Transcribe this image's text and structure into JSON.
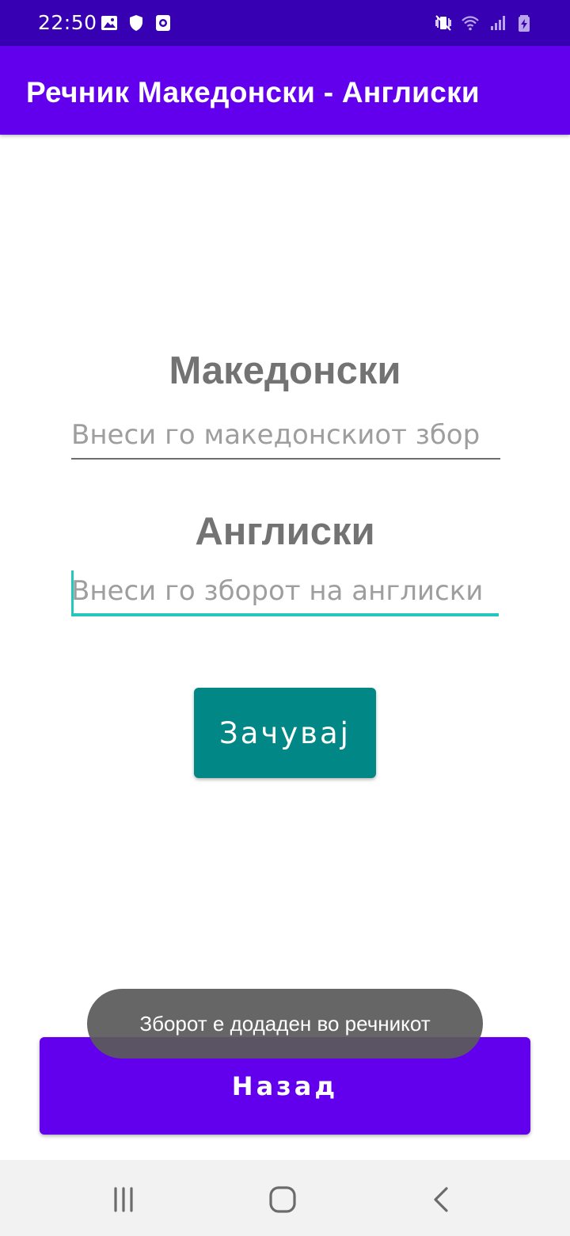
{
  "status_bar": {
    "time": "22:50",
    "left_icons": [
      "image-icon",
      "shield-icon",
      "screen-record-icon"
    ],
    "right_icons": [
      "vibrate-mute-icon",
      "wifi-icon",
      "signal-icon",
      "battery-charging-icon"
    ]
  },
  "app_bar": {
    "title": "Речник Македонски - Англиски"
  },
  "form": {
    "macedonian_label": "Македонски",
    "macedonian_placeholder": "Внеси го македонскиот збор",
    "english_label": "Англиски",
    "english_placeholder": "Внеси го зборот на англиски",
    "save_label": "Зачувај"
  },
  "toast": {
    "message": "Зборот е додаден во речникот"
  },
  "back_button": {
    "label": "Назад"
  },
  "nav_bar": {
    "buttons": [
      "recents-icon",
      "home-icon",
      "back-icon"
    ]
  },
  "colors": {
    "status_bar": "#3700b3",
    "primary": "#6200ee",
    "secondary": "#018786",
    "accent": "#26c6bf",
    "label_gray": "#737373"
  }
}
